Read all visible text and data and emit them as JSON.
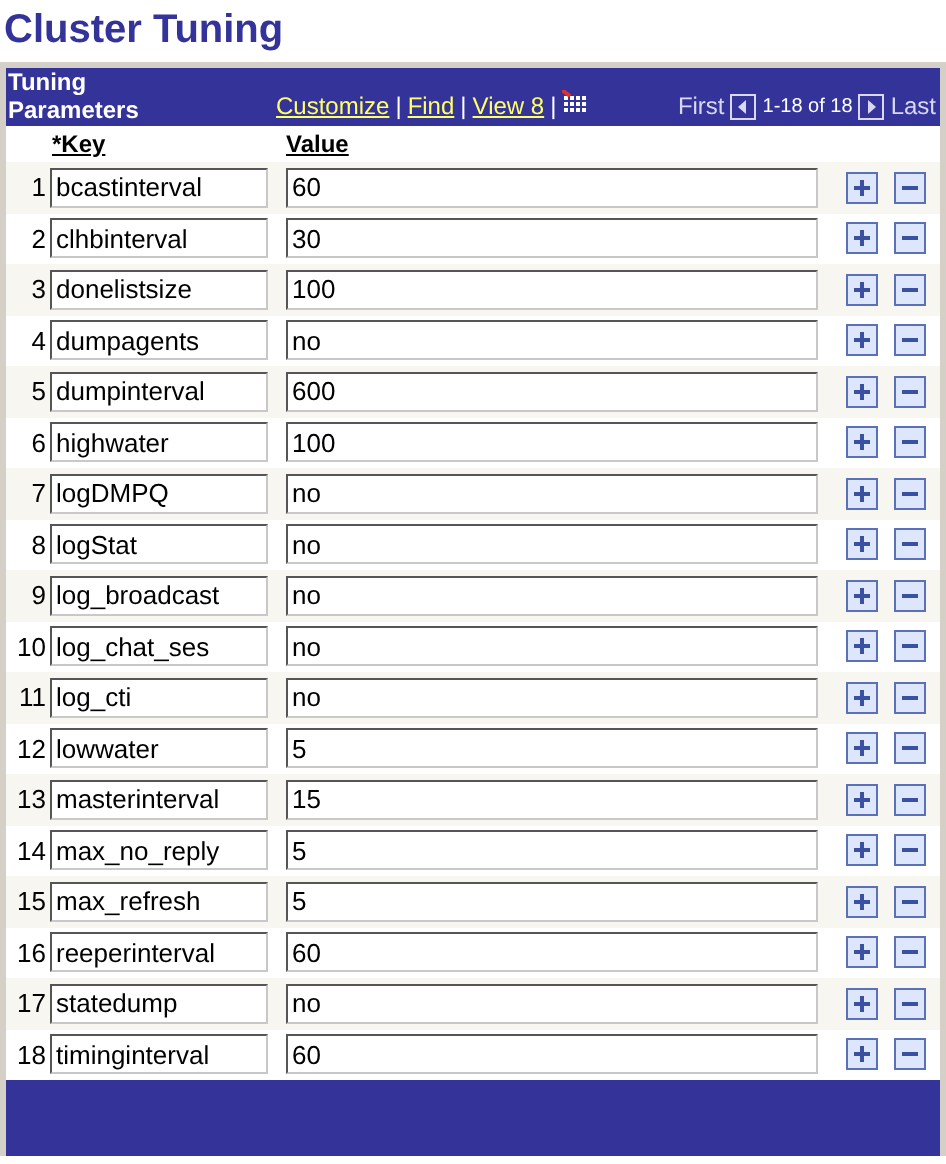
{
  "page_title": "Cluster Tuning",
  "grid": {
    "title": "Tuning Parameters",
    "links": [
      "Customize",
      "Find",
      "View 8"
    ],
    "separator": "|",
    "nav": {
      "first": "First",
      "range": "1-18 of 18",
      "last": "Last"
    },
    "columns": [
      "*Key",
      "Value"
    ],
    "rows": [
      {
        "number": "1",
        "key": "bcastinterval",
        "value": "60"
      },
      {
        "number": "2",
        "key": "clhbinterval",
        "value": "30"
      },
      {
        "number": "3",
        "key": "donelistsize",
        "value": "100"
      },
      {
        "number": "4",
        "key": "dumpagents",
        "value": "no"
      },
      {
        "number": "5",
        "key": "dumpinterval",
        "value": "600"
      },
      {
        "number": "6",
        "key": "highwater",
        "value": "100"
      },
      {
        "number": "7",
        "key": "logDMPQ",
        "value": "no"
      },
      {
        "number": "8",
        "key": "logStat",
        "value": "no"
      },
      {
        "number": "9",
        "key": "log_broadcast",
        "value": "no"
      },
      {
        "number": "10",
        "key": "log_chat_ses",
        "value": "no"
      },
      {
        "number": "11",
        "key": "log_cti",
        "value": "no"
      },
      {
        "number": "12",
        "key": "lowwater",
        "value": "5"
      },
      {
        "number": "13",
        "key": "masterinterval",
        "value": "15"
      },
      {
        "number": "14",
        "key": "max_no_reply",
        "value": "5"
      },
      {
        "number": "15",
        "key": "max_refresh",
        "value": "5"
      },
      {
        "number": "16",
        "key": "reeperinterval",
        "value": "60"
      },
      {
        "number": "17",
        "key": "statedump",
        "value": "no"
      },
      {
        "number": "18",
        "key": "timinginterval",
        "value": "60"
      }
    ]
  }
}
